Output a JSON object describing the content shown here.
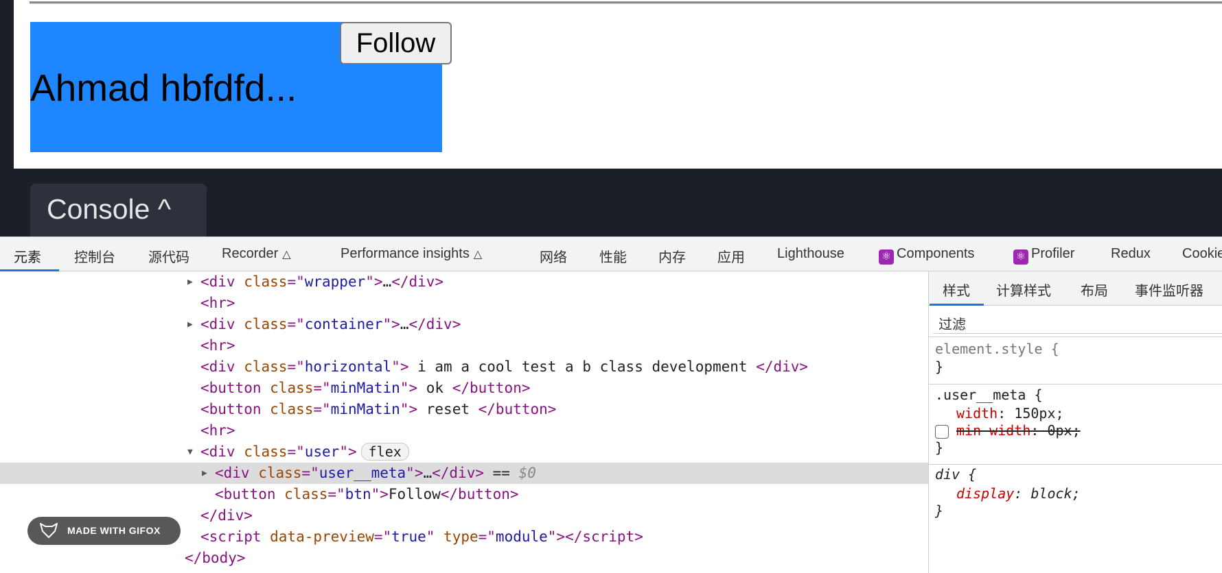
{
  "preview": {
    "name": "Ahmad hbfdfd...",
    "follow_label": "Follow",
    "meta_color": "#1e87ff"
  },
  "console_tab": {
    "label": "Console",
    "chevron": "^"
  },
  "devtools_tabs": [
    "元素",
    "控制台",
    "源代码",
    "Recorder",
    "Performance insights",
    "网络",
    "性能",
    "内存",
    "应用",
    "Lighthouse",
    "Components",
    "Profiler",
    "Redux",
    "Cookies"
  ],
  "elements": [
    {
      "parts": [
        [
          "t",
          "<div "
        ],
        [
          "a",
          "class"
        ],
        [
          "t",
          "=\""
        ],
        [
          "v",
          "wrapper"
        ],
        [
          "t",
          "\">"
        ],
        [
          "",
          "…"
        ],
        [
          "t",
          "</div>"
        ]
      ]
    },
    {
      "parts": [
        [
          "t",
          "<hr>"
        ]
      ]
    },
    {
      "parts": [
        [
          "t",
          "<div "
        ],
        [
          "a",
          "class"
        ],
        [
          "t",
          "=\""
        ],
        [
          "v",
          "container"
        ],
        [
          "t",
          "\">"
        ],
        [
          "",
          "…"
        ],
        [
          "t",
          "</div>"
        ]
      ]
    },
    {
      "parts": [
        [
          "t",
          "<hr>"
        ]
      ]
    },
    {
      "parts": [
        [
          "t",
          "<div "
        ],
        [
          "a",
          "class"
        ],
        [
          "t",
          "=\""
        ],
        [
          "v",
          "horizontal"
        ],
        [
          "t",
          "\">"
        ],
        [
          "",
          " i am a cool test a b class development "
        ],
        [
          "t",
          "</div>"
        ]
      ]
    },
    {
      "parts": [
        [
          "t",
          "<button "
        ],
        [
          "a",
          "class"
        ],
        [
          "t",
          "=\""
        ],
        [
          "v",
          "minMatin"
        ],
        [
          "t",
          "\">"
        ],
        [
          "",
          " ok "
        ],
        [
          "t",
          "</button>"
        ]
      ]
    },
    {
      "parts": [
        [
          "t",
          "<button "
        ],
        [
          "a",
          "class"
        ],
        [
          "t",
          "=\""
        ],
        [
          "v",
          "minMatin"
        ],
        [
          "t",
          "\">"
        ],
        [
          "",
          " reset "
        ],
        [
          "t",
          "</button>"
        ]
      ]
    },
    {
      "parts": [
        [
          "t",
          "<hr>"
        ]
      ]
    },
    {
      "parts": [
        [
          "t",
          "<div "
        ],
        [
          "a",
          "class"
        ],
        [
          "t",
          "=\""
        ],
        [
          "v",
          "user"
        ],
        [
          "t",
          "\">"
        ]
      ],
      "badge": "flex"
    },
    {
      "parts": [
        [
          "t",
          "<div "
        ],
        [
          "a",
          "class"
        ],
        [
          "t",
          "=\""
        ],
        [
          "v",
          "user__meta"
        ],
        [
          "t",
          "\">"
        ],
        [
          "",
          "…"
        ],
        [
          "t",
          "</div>"
        ],
        [
          "",
          " == "
        ],
        [
          "g",
          "$0"
        ]
      ]
    },
    {
      "parts": [
        [
          "t",
          "<button "
        ],
        [
          "a",
          "class"
        ],
        [
          "t",
          "=\""
        ],
        [
          "v",
          "btn"
        ],
        [
          "t",
          "\">"
        ],
        [
          "",
          "Follow"
        ],
        [
          "t",
          "</button>"
        ]
      ]
    },
    {
      "parts": [
        [
          "t",
          "</div>"
        ]
      ]
    },
    {
      "parts": [
        [
          "t",
          "<script "
        ],
        [
          "a",
          "data-preview"
        ],
        [
          "t",
          "=\""
        ],
        [
          "v",
          "true"
        ],
        [
          "t",
          "\" "
        ],
        [
          "a",
          "type"
        ],
        [
          "t",
          "=\""
        ],
        [
          "v",
          "module"
        ],
        [
          "t",
          "\"></script>"
        ]
      ]
    },
    {
      "parts": [
        [
          "t",
          "</body>"
        ]
      ]
    }
  ],
  "styles": {
    "tabs": [
      "样式",
      "计算样式",
      "布局",
      "事件监听器"
    ],
    "filter_placeholder": "过滤",
    "rule1_selector": "element.style {",
    "close": "}",
    "rule2_selector": ".user__meta {",
    "rule2_prop1": "width",
    "rule2_val1": ": 150px;",
    "rule2_prop2": "min-width",
    "rule2_val2": ": 0px;",
    "rule3_selector": "div {",
    "rule3_prop": "display",
    "rule3_val": ": block;"
  },
  "watermark": "MADE WITH GIFOX"
}
